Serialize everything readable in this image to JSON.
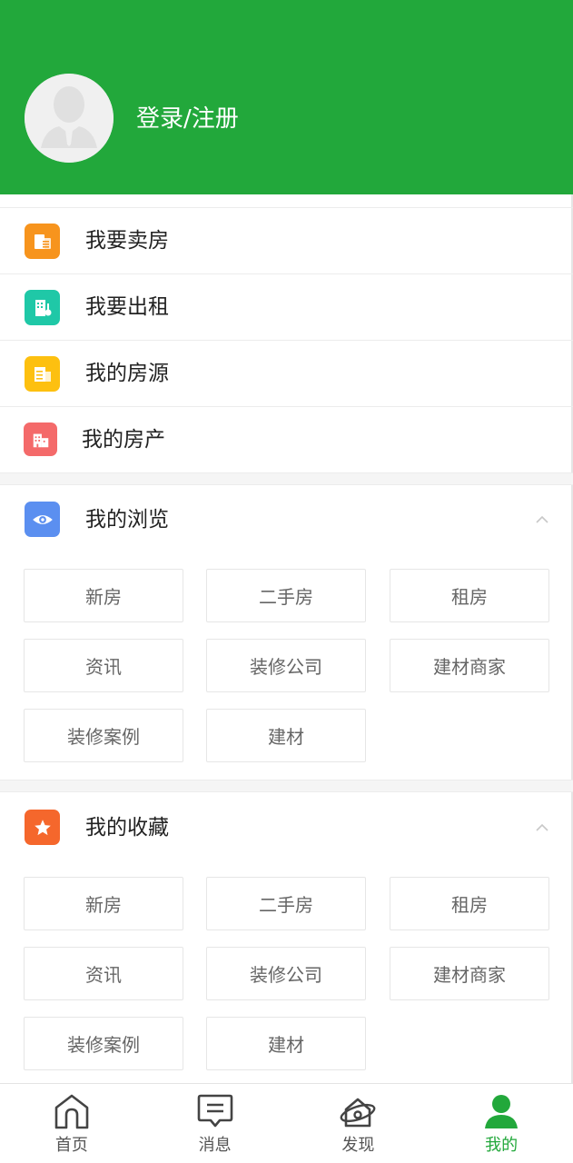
{
  "header": {
    "login_label": "登录/注册",
    "bg_color": "#22a83b"
  },
  "menu": {
    "items": [
      {
        "label": "我要卖房",
        "icon": "sell-house-icon",
        "color": "#f7941d"
      },
      {
        "label": "我要出租",
        "icon": "rent-out-icon",
        "color": "#1fc8a7"
      },
      {
        "label": "我的房源",
        "icon": "my-listings-icon",
        "color": "#fdc010"
      },
      {
        "label": "我的房产",
        "icon": "my-property-icon",
        "color": "#f46a6a"
      }
    ]
  },
  "browse": {
    "title": "我的浏览",
    "icon": "eye-icon",
    "color": "#5b8ff0",
    "tags": [
      "新房",
      "二手房",
      "租房",
      "资讯",
      "装修公司",
      "建材商家",
      "装修案例",
      "建材"
    ]
  },
  "favorites": {
    "title": "我的收藏",
    "icon": "star-icon",
    "color": "#f5672c",
    "tags": [
      "新房",
      "二手房",
      "租房",
      "资讯",
      "装修公司",
      "建材商家",
      "装修案例",
      "建材"
    ]
  },
  "tabbar": {
    "items": [
      {
        "label": "首页",
        "icon": "home-icon",
        "active": false
      },
      {
        "label": "消息",
        "icon": "message-icon",
        "active": false
      },
      {
        "label": "发现",
        "icon": "discover-icon",
        "active": false
      },
      {
        "label": "我的",
        "icon": "profile-icon",
        "active": true
      }
    ],
    "active_color": "#22a83b"
  }
}
